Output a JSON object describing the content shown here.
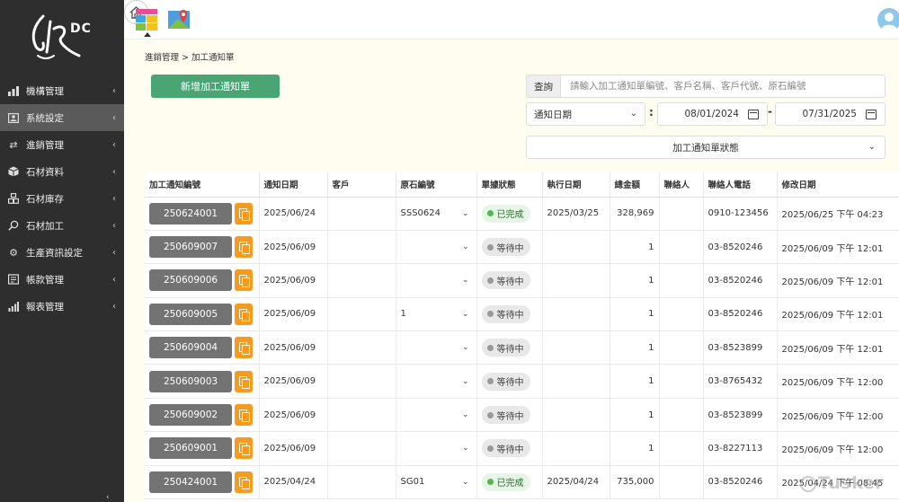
{
  "brand": {
    "logo_text": "DC"
  },
  "sidebar": {
    "items": [
      {
        "label": "機構管理",
        "icon": "bar-chart-icon",
        "active": false
      },
      {
        "label": "系統設定",
        "icon": "user-card-icon",
        "active": true
      },
      {
        "label": "進銷管理",
        "icon": "exchange-icon",
        "active": false
      },
      {
        "label": "石材資料",
        "icon": "cube-icon",
        "active": false
      },
      {
        "label": "石材庫存",
        "icon": "warehouse-icon",
        "active": false
      },
      {
        "label": "石材加工",
        "icon": "search-icon",
        "active": false
      },
      {
        "label": "生產資訊設定",
        "icon": "gear-icon",
        "active": false
      },
      {
        "label": "帳款管理",
        "icon": "ledger-icon",
        "active": false
      },
      {
        "label": "報表管理",
        "icon": "report-icon",
        "active": false
      }
    ]
  },
  "breadcrumb": {
    "text": "進銷管理 > 加工通知單"
  },
  "toolbar": {
    "new_label": "新增加工通知單"
  },
  "search": {
    "label": "查詢",
    "placeholder": "請輸入加工通知單編號、客戶名稱、客戶代號、原石編號"
  },
  "filters": {
    "date_type": "通知日期",
    "date_from": "08/01/2024",
    "date_to": "07/31/2025",
    "sep_colon": ":",
    "sep_dash": "-",
    "status_placeholder": "加工通知單狀態"
  },
  "table": {
    "headers": [
      "加工通知編號",
      "通知日期",
      "客戶",
      "原石編號",
      "單據狀態",
      "執行日期",
      "總金額",
      "聯絡人",
      "聯絡人電話",
      "修改日期"
    ],
    "rows": [
      {
        "id": "250624001",
        "date": "2025/06/24",
        "stone": "SSS0624",
        "status": "已完成",
        "status_type": "done",
        "exec_date": "2025/03/25",
        "amount": "328,969",
        "phone": "0910-123456",
        "modified": "2025/06/25 下午 04:23"
      },
      {
        "id": "250609007",
        "date": "2025/06/09",
        "stone": "",
        "status": "等待中",
        "status_type": "wait",
        "exec_date": "",
        "amount": "1",
        "phone": "03-8520246",
        "modified": "2025/06/09 下午 12:01"
      },
      {
        "id": "250609006",
        "date": "2025/06/09",
        "stone": "",
        "status": "等待中",
        "status_type": "wait",
        "exec_date": "",
        "amount": "1",
        "phone": "03-8520246",
        "modified": "2025/06/09 下午 12:01"
      },
      {
        "id": "250609005",
        "date": "2025/06/09",
        "stone": "1",
        "status": "等待中",
        "status_type": "wait",
        "exec_date": "",
        "amount": "1",
        "phone": "03-8520246",
        "modified": "2025/06/09 下午 12:01"
      },
      {
        "id": "250609004",
        "date": "2025/06/09",
        "stone": "",
        "status": "等待中",
        "status_type": "wait",
        "exec_date": "",
        "amount": "1",
        "phone": "03-8523899",
        "modified": "2025/06/09 下午 12:01"
      },
      {
        "id": "250609003",
        "date": "2025/06/09",
        "stone": "",
        "status": "等待中",
        "status_type": "wait",
        "exec_date": "",
        "amount": "1",
        "phone": "03-8765432",
        "modified": "2025/06/09 下午 12:00"
      },
      {
        "id": "250609002",
        "date": "2025/06/09",
        "stone": "",
        "status": "等待中",
        "status_type": "wait",
        "exec_date": "",
        "amount": "1",
        "phone": "03-8523899",
        "modified": "2025/06/09 下午 12:00"
      },
      {
        "id": "250609001",
        "date": "2025/06/09",
        "stone": "",
        "status": "等待中",
        "status_type": "wait",
        "exec_date": "",
        "amount": "1",
        "phone": "03-8227113",
        "modified": "2025/06/09 下午 12:00"
      },
      {
        "id": "250424001",
        "date": "2025/04/24",
        "stone": "SG01",
        "status": "已完成",
        "status_type": "done",
        "exec_date": "2025/04/24",
        "amount": "735,000",
        "phone": "03-8520246",
        "modified": "2025/04/24 下午 08:45"
      }
    ]
  },
  "watermark": {
    "text": "Tusker"
  },
  "colors": {
    "sidebar_bg": "#2e2e2e",
    "primary_green": "#4aa574",
    "copy_orange": "#f49b20",
    "id_gray": "#737373",
    "page_bg": "#fffdf0"
  }
}
